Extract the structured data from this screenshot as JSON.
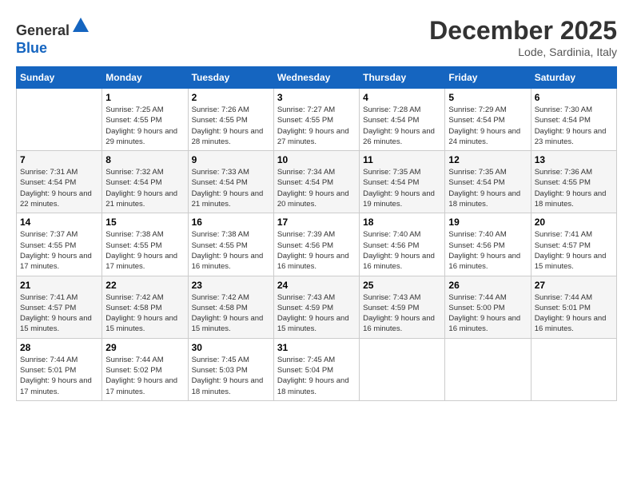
{
  "header": {
    "logo_line1": "General",
    "logo_line2": "Blue",
    "month": "December 2025",
    "location": "Lode, Sardinia, Italy"
  },
  "days_of_week": [
    "Sunday",
    "Monday",
    "Tuesday",
    "Wednesday",
    "Thursday",
    "Friday",
    "Saturday"
  ],
  "weeks": [
    [
      {
        "num": "",
        "sunrise": "",
        "sunset": "",
        "daylight": ""
      },
      {
        "num": "1",
        "sunrise": "Sunrise: 7:25 AM",
        "sunset": "Sunset: 4:55 PM",
        "daylight": "Daylight: 9 hours and 29 minutes."
      },
      {
        "num": "2",
        "sunrise": "Sunrise: 7:26 AM",
        "sunset": "Sunset: 4:55 PM",
        "daylight": "Daylight: 9 hours and 28 minutes."
      },
      {
        "num": "3",
        "sunrise": "Sunrise: 7:27 AM",
        "sunset": "Sunset: 4:55 PM",
        "daylight": "Daylight: 9 hours and 27 minutes."
      },
      {
        "num": "4",
        "sunrise": "Sunrise: 7:28 AM",
        "sunset": "Sunset: 4:54 PM",
        "daylight": "Daylight: 9 hours and 26 minutes."
      },
      {
        "num": "5",
        "sunrise": "Sunrise: 7:29 AM",
        "sunset": "Sunset: 4:54 PM",
        "daylight": "Daylight: 9 hours and 24 minutes."
      },
      {
        "num": "6",
        "sunrise": "Sunrise: 7:30 AM",
        "sunset": "Sunset: 4:54 PM",
        "daylight": "Daylight: 9 hours and 23 minutes."
      }
    ],
    [
      {
        "num": "7",
        "sunrise": "Sunrise: 7:31 AM",
        "sunset": "Sunset: 4:54 PM",
        "daylight": "Daylight: 9 hours and 22 minutes."
      },
      {
        "num": "8",
        "sunrise": "Sunrise: 7:32 AM",
        "sunset": "Sunset: 4:54 PM",
        "daylight": "Daylight: 9 hours and 21 minutes."
      },
      {
        "num": "9",
        "sunrise": "Sunrise: 7:33 AM",
        "sunset": "Sunset: 4:54 PM",
        "daylight": "Daylight: 9 hours and 21 minutes."
      },
      {
        "num": "10",
        "sunrise": "Sunrise: 7:34 AM",
        "sunset": "Sunset: 4:54 PM",
        "daylight": "Daylight: 9 hours and 20 minutes."
      },
      {
        "num": "11",
        "sunrise": "Sunrise: 7:35 AM",
        "sunset": "Sunset: 4:54 PM",
        "daylight": "Daylight: 9 hours and 19 minutes."
      },
      {
        "num": "12",
        "sunrise": "Sunrise: 7:35 AM",
        "sunset": "Sunset: 4:54 PM",
        "daylight": "Daylight: 9 hours and 18 minutes."
      },
      {
        "num": "13",
        "sunrise": "Sunrise: 7:36 AM",
        "sunset": "Sunset: 4:55 PM",
        "daylight": "Daylight: 9 hours and 18 minutes."
      }
    ],
    [
      {
        "num": "14",
        "sunrise": "Sunrise: 7:37 AM",
        "sunset": "Sunset: 4:55 PM",
        "daylight": "Daylight: 9 hours and 17 minutes."
      },
      {
        "num": "15",
        "sunrise": "Sunrise: 7:38 AM",
        "sunset": "Sunset: 4:55 PM",
        "daylight": "Daylight: 9 hours and 17 minutes."
      },
      {
        "num": "16",
        "sunrise": "Sunrise: 7:38 AM",
        "sunset": "Sunset: 4:55 PM",
        "daylight": "Daylight: 9 hours and 16 minutes."
      },
      {
        "num": "17",
        "sunrise": "Sunrise: 7:39 AM",
        "sunset": "Sunset: 4:56 PM",
        "daylight": "Daylight: 9 hours and 16 minutes."
      },
      {
        "num": "18",
        "sunrise": "Sunrise: 7:40 AM",
        "sunset": "Sunset: 4:56 PM",
        "daylight": "Daylight: 9 hours and 16 minutes."
      },
      {
        "num": "19",
        "sunrise": "Sunrise: 7:40 AM",
        "sunset": "Sunset: 4:56 PM",
        "daylight": "Daylight: 9 hours and 16 minutes."
      },
      {
        "num": "20",
        "sunrise": "Sunrise: 7:41 AM",
        "sunset": "Sunset: 4:57 PM",
        "daylight": "Daylight: 9 hours and 15 minutes."
      }
    ],
    [
      {
        "num": "21",
        "sunrise": "Sunrise: 7:41 AM",
        "sunset": "Sunset: 4:57 PM",
        "daylight": "Daylight: 9 hours and 15 minutes."
      },
      {
        "num": "22",
        "sunrise": "Sunrise: 7:42 AM",
        "sunset": "Sunset: 4:58 PM",
        "daylight": "Daylight: 9 hours and 15 minutes."
      },
      {
        "num": "23",
        "sunrise": "Sunrise: 7:42 AM",
        "sunset": "Sunset: 4:58 PM",
        "daylight": "Daylight: 9 hours and 15 minutes."
      },
      {
        "num": "24",
        "sunrise": "Sunrise: 7:43 AM",
        "sunset": "Sunset: 4:59 PM",
        "daylight": "Daylight: 9 hours and 15 minutes."
      },
      {
        "num": "25",
        "sunrise": "Sunrise: 7:43 AM",
        "sunset": "Sunset: 4:59 PM",
        "daylight": "Daylight: 9 hours and 16 minutes."
      },
      {
        "num": "26",
        "sunrise": "Sunrise: 7:44 AM",
        "sunset": "Sunset: 5:00 PM",
        "daylight": "Daylight: 9 hours and 16 minutes."
      },
      {
        "num": "27",
        "sunrise": "Sunrise: 7:44 AM",
        "sunset": "Sunset: 5:01 PM",
        "daylight": "Daylight: 9 hours and 16 minutes."
      }
    ],
    [
      {
        "num": "28",
        "sunrise": "Sunrise: 7:44 AM",
        "sunset": "Sunset: 5:01 PM",
        "daylight": "Daylight: 9 hours and 17 minutes."
      },
      {
        "num": "29",
        "sunrise": "Sunrise: 7:44 AM",
        "sunset": "Sunset: 5:02 PM",
        "daylight": "Daylight: 9 hours and 17 minutes."
      },
      {
        "num": "30",
        "sunrise": "Sunrise: 7:45 AM",
        "sunset": "Sunset: 5:03 PM",
        "daylight": "Daylight: 9 hours and 18 minutes."
      },
      {
        "num": "31",
        "sunrise": "Sunrise: 7:45 AM",
        "sunset": "Sunset: 5:04 PM",
        "daylight": "Daylight: 9 hours and 18 minutes."
      },
      {
        "num": "",
        "sunrise": "",
        "sunset": "",
        "daylight": ""
      },
      {
        "num": "",
        "sunrise": "",
        "sunset": "",
        "daylight": ""
      },
      {
        "num": "",
        "sunrise": "",
        "sunset": "",
        "daylight": ""
      }
    ]
  ]
}
